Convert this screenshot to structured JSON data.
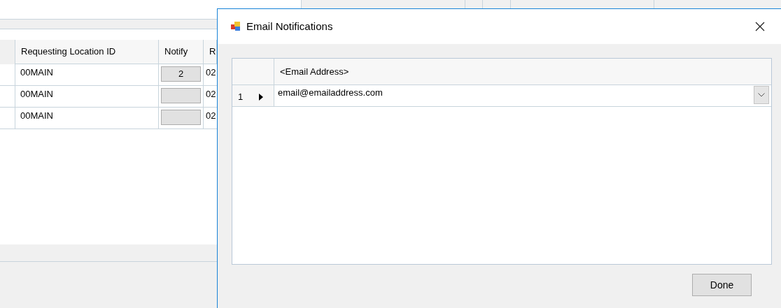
{
  "background_grid": {
    "columns": [
      "Requesting Location ID",
      "Notify",
      "R"
    ],
    "rows": [
      {
        "location": "00MAIN",
        "notify": "2",
        "column_3": "02"
      },
      {
        "location": "00MAIN",
        "notify": "",
        "column_3": "02"
      },
      {
        "location": "00MAIN",
        "notify": "",
        "column_3": "02"
      }
    ]
  },
  "dialog": {
    "title": "Email Notifications",
    "columns": [
      "<Email Address>"
    ],
    "rows": [
      {
        "number": "1",
        "current": true,
        "email": "email@emailaddress.com"
      }
    ],
    "buttons": [
      "Done"
    ]
  }
}
